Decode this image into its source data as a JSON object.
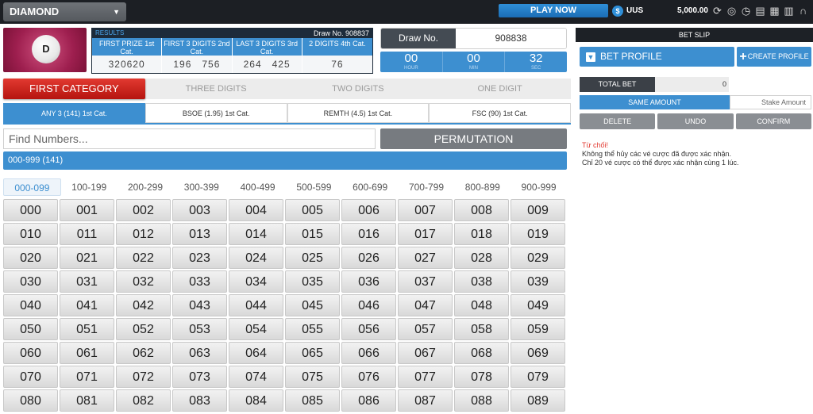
{
  "topbar": {
    "game": "DIAMOND",
    "play_now": "PLAY NOW",
    "currency_symbol": "$",
    "currency": "UUS",
    "balance": "5,000.00",
    "icons": [
      "refresh-icon",
      "chip-icon",
      "history-icon",
      "document-icon",
      "clipboard-icon",
      "book-icon",
      "headset-icon"
    ]
  },
  "logo": {
    "letter": "D"
  },
  "results": {
    "label": "RESULTS",
    "draw_no": "Draw No. 908837",
    "columns": [
      {
        "header": "FIRST PRIZE 1st Cat.",
        "value": "320620"
      },
      {
        "header": "FIRST 3 DIGITS 2nd Cat.",
        "value": "196   756"
      },
      {
        "header": "LAST 3 DIGITS 3rd Cat.",
        "value": "264   425"
      },
      {
        "header": "2 DIGITS 4th Cat.",
        "value": "76"
      }
    ]
  },
  "draw": {
    "label": "Draw No.",
    "value": "908838",
    "timer": [
      {
        "value": "00",
        "unit": "HOUR"
      },
      {
        "value": "00",
        "unit": "MIN"
      },
      {
        "value": "32",
        "unit": "SEC"
      }
    ]
  },
  "categories": [
    "FIRST CATEGORY",
    "THREE DIGITS",
    "TWO DIGITS",
    "ONE DIGIT"
  ],
  "sub_tabs": [
    "ANY 3 (141) 1st Cat.",
    "BSOE (1.95) 1st Cat.",
    "REMTH (4.5) 1st Cat.",
    "FSC (90) 1st Cat."
  ],
  "find": {
    "placeholder": "Find Numbers..."
  },
  "permutation": "PERMUTATION",
  "range_bar": "000-999 (141)",
  "ranges": [
    "000-099",
    "100-199",
    "200-299",
    "300-399",
    "400-499",
    "500-599",
    "600-699",
    "700-799",
    "800-899",
    "900-999"
  ],
  "numbers": [
    "000",
    "001",
    "002",
    "003",
    "004",
    "005",
    "006",
    "007",
    "008",
    "009",
    "010",
    "011",
    "012",
    "013",
    "014",
    "015",
    "016",
    "017",
    "018",
    "019",
    "020",
    "021",
    "022",
    "023",
    "024",
    "025",
    "026",
    "027",
    "028",
    "029",
    "030",
    "031",
    "032",
    "033",
    "034",
    "035",
    "036",
    "037",
    "038",
    "039",
    "040",
    "041",
    "042",
    "043",
    "044",
    "045",
    "046",
    "047",
    "048",
    "049",
    "050",
    "051",
    "052",
    "053",
    "054",
    "055",
    "056",
    "057",
    "058",
    "059",
    "060",
    "061",
    "062",
    "063",
    "064",
    "065",
    "066",
    "067",
    "068",
    "069",
    "070",
    "071",
    "072",
    "073",
    "074",
    "075",
    "076",
    "077",
    "078",
    "079",
    "080",
    "081",
    "082",
    "083",
    "084",
    "085",
    "086",
    "087",
    "088",
    "089"
  ],
  "bet_slip": {
    "title": "BET SLIP",
    "bet_profile": "BET PROFILE",
    "create_profile": "CREATE PROFILE",
    "total_bet_label": "TOTAL BET",
    "total_bet_value": "0",
    "same_amount": "SAME AMOUNT",
    "stake_amount": "Stake Amount",
    "delete": "DELETE",
    "undo": "UNDO",
    "confirm": "CONFIRM",
    "msg_title": "Từ chối!",
    "msg_line1": "Không thể hủy các vé cược đã được xác nhận.",
    "msg_line2": "Chỉ 20 vé cược có thể được xác nhận cùng 1 lúc."
  }
}
